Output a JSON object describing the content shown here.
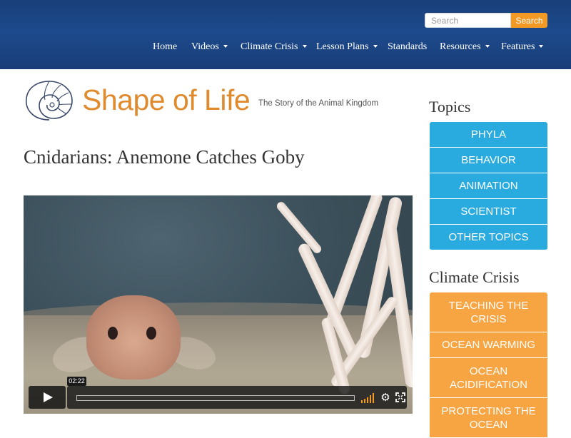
{
  "header": {
    "search_placeholder": "Search",
    "search_button": "Search",
    "nav": [
      {
        "label": "Home",
        "dropdown": false
      },
      {
        "label": "Videos",
        "dropdown": true
      },
      {
        "label": "Climate Crisis",
        "dropdown": true
      },
      {
        "label": "Lesson Plans",
        "dropdown": true
      },
      {
        "label": "Standards",
        "dropdown": false
      },
      {
        "label": "Resources",
        "dropdown": true
      },
      {
        "label": "Features",
        "dropdown": true
      }
    ]
  },
  "logo": {
    "name": "Shape of Life",
    "tagline": "The Story of the Animal Kingdom"
  },
  "page_title": "Cnidarians: Anemone Catches Goby",
  "video": {
    "time": "02:22"
  },
  "sidebar": {
    "topics_title": "Topics",
    "topics": [
      "PHYLA",
      "BEHAVIOR",
      "ANIMATION",
      "SCIENTIST",
      "OTHER TOPICS"
    ],
    "climate_title": "Climate Crisis",
    "climate": [
      "TEACHING THE CRISIS",
      "OCEAN WARMING",
      "OCEAN ACIDIFICATION",
      "PROTECTING THE OCEAN"
    ]
  },
  "colors": {
    "header_blue": "#1c4a8c",
    "accent_orange": "#f39a25",
    "topic_blue": "#29abe0",
    "climate_orange": "#f7a442",
    "logo_orange": "#e08a2e"
  }
}
